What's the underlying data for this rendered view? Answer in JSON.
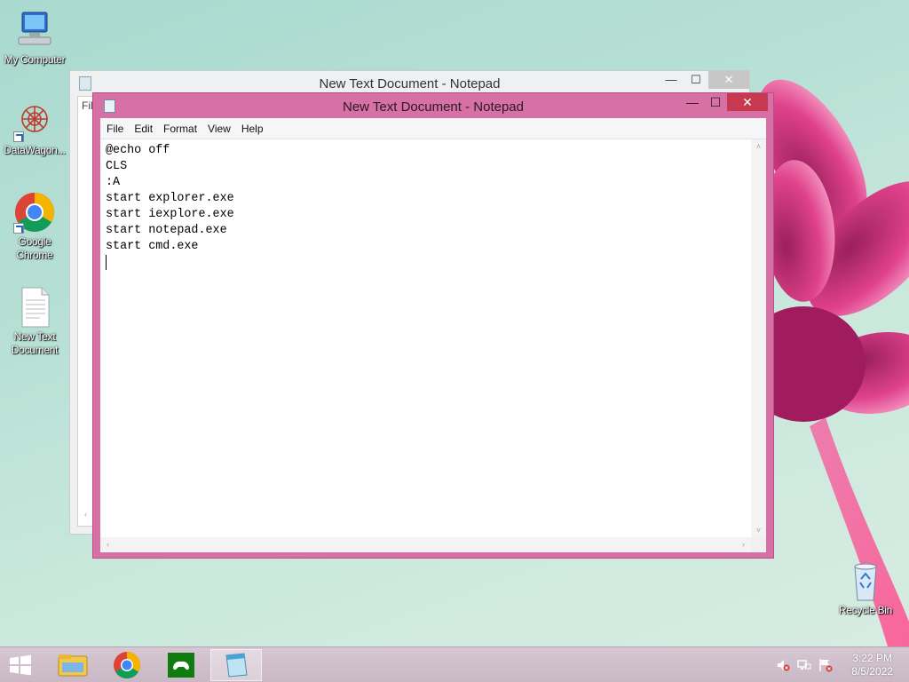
{
  "desktop": {
    "icons": [
      {
        "label": "My Computer",
        "icon": "computer-icon"
      },
      {
        "label": "DataWagon...",
        "icon": "datawagon-icon"
      },
      {
        "label": "Google Chrome",
        "icon": "chrome-icon"
      },
      {
        "label": "New Text Document",
        "icon": "text-document-icon"
      },
      {
        "label": "Recycle Bin",
        "icon": "recycle-bin-icon"
      }
    ]
  },
  "back_window": {
    "title": "New Text Document - Notepad",
    "menu_peek": "Fil",
    "minimize": "—",
    "maximize": "☐",
    "close": "✕"
  },
  "window": {
    "title": "New Text Document - Notepad",
    "minimize": "—",
    "maximize": "☐",
    "close": "✕",
    "menu": [
      "File",
      "Edit",
      "Format",
      "View",
      "Help"
    ],
    "lines": [
      "@echo off",
      "CLS",
      ":A",
      "start explorer.exe",
      "start iexplore.exe",
      "start notepad.exe",
      "start cmd.exe",
      ""
    ]
  },
  "taskbar": {
    "items": [
      "windows-start-icon",
      "file-explorer-icon",
      "chrome-icon",
      "xbox-games-icon",
      "notepad-icon"
    ],
    "time": "3:22 PM",
    "date": "8/5/2022",
    "tray": [
      "network-icon",
      "flag-icon",
      "volume-muted-icon"
    ]
  },
  "colors": {
    "window_frame": "#d770a4",
    "close_button": "#c7394f",
    "taskbar": "#d0bfcc"
  }
}
